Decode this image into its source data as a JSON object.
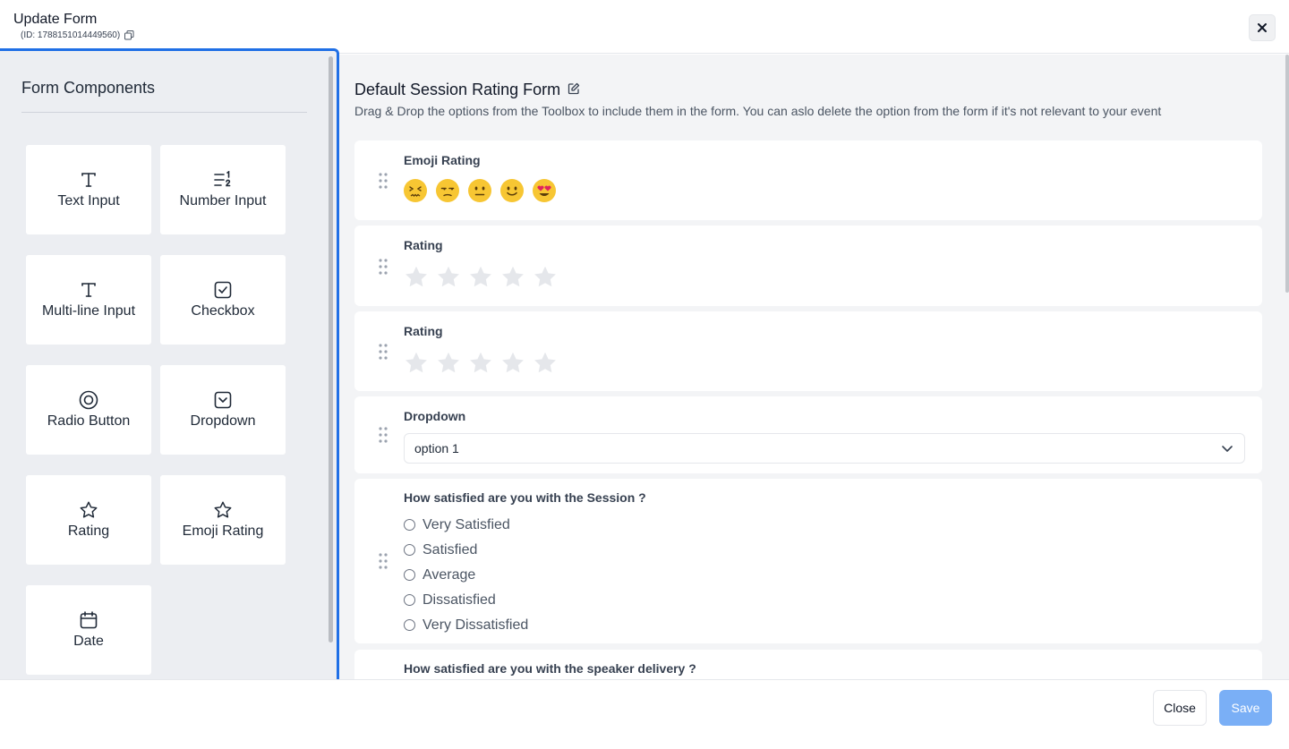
{
  "header": {
    "title": "Update Form",
    "form_id": "(ID: 1788151014449560)"
  },
  "toolbox": {
    "title": "Form Components",
    "items": [
      {
        "label": "Text Input",
        "icon": "text-icon"
      },
      {
        "label": "Number Input",
        "icon": "number-list-icon"
      },
      {
        "label": "Multi-line Input",
        "icon": "text-icon"
      },
      {
        "label": "Checkbox",
        "icon": "checkbox-icon"
      },
      {
        "label": "Radio Button",
        "icon": "radio-icon"
      },
      {
        "label": "Dropdown",
        "icon": "dropdown-icon"
      },
      {
        "label": "Rating",
        "icon": "star-icon"
      },
      {
        "label": "Emoji Rating",
        "icon": "star-icon"
      },
      {
        "label": "Date",
        "icon": "calendar-icon"
      }
    ]
  },
  "form": {
    "title": "Default Session Rating Form",
    "description": "Drag & Drop the options from the Toolbox to include them in the form. You can aslo delete the option from the form if it's not relevant to your event",
    "fields": [
      {
        "label": "Emoji Rating",
        "type": "emoji",
        "emojis": [
          "😖",
          "😒",
          "😐",
          "🙂",
          "😍"
        ]
      },
      {
        "label": "Rating",
        "type": "rating",
        "stars": 5
      },
      {
        "label": "Rating",
        "type": "rating",
        "stars": 5
      },
      {
        "label": "Dropdown",
        "type": "dropdown",
        "selected": "option 1"
      },
      {
        "label": "How satisfied are you with the Session ?",
        "type": "radio",
        "options": [
          "Very Satisfied",
          "Satisfied",
          "Average",
          "Dissatisfied",
          "Very Dissatisfied"
        ]
      },
      {
        "label": "How satisfied are you with the speaker delivery ?",
        "type": "radio"
      }
    ]
  },
  "footer": {
    "close_label": "Close",
    "save_label": "Save"
  },
  "colors": {
    "accent_border": "#1f6fe6",
    "save_button": "#7aaff6",
    "emoji_yellow": "#f7c633",
    "star_inactive": "#e5e7eb"
  }
}
